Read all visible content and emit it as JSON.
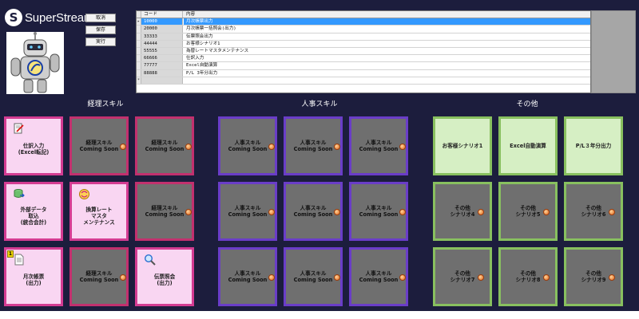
{
  "app": {
    "logo_text": "SuperStream",
    "logo_mark": "S"
  },
  "commands": [
    {
      "label": "取消"
    },
    {
      "label": "保存"
    },
    {
      "label": "実行"
    }
  ],
  "grid": {
    "headers": {
      "code": "コード",
      "content": "内容"
    },
    "rows": [
      {
        "code": "10000",
        "content": "月次帳票出力",
        "selected": true
      },
      {
        "code": "20000",
        "content": "月次帳票一括照会(出力)"
      },
      {
        "code": "33333",
        "content": "伝票照会出力"
      },
      {
        "code": "44444",
        "content": "お客様シナリオ1"
      },
      {
        "code": "55555",
        "content": "為替レートマスタメンテナンス"
      },
      {
        "code": "66666",
        "content": "仕訳入力"
      },
      {
        "code": "77777",
        "content": "Excel自動演算"
      },
      {
        "code": "88888",
        "content": "P/L 3年分出力"
      }
    ],
    "selected_marker": "▸",
    "new_row_marker": "*"
  },
  "sections": {
    "keiri": {
      "title": "経理スキル"
    },
    "jinji": {
      "title": "人事スキル"
    },
    "other": {
      "title": "その他"
    }
  },
  "tiles": {
    "keiri": [
      {
        "label": "仕訳入力\n(Excel転記)",
        "kind": "active",
        "icon": "document-pen-icon"
      },
      {
        "label": "経理スキル\nComing Soon",
        "kind": "soon"
      },
      {
        "label": "経理スキル\nComing Soon",
        "kind": "soon"
      },
      {
        "label": "外部データ\n取込\n(統合会計)",
        "kind": "active",
        "icon": "database-import-icon"
      },
      {
        "label": "換算レート\nマスタ\nメンテナンス",
        "kind": "active",
        "icon": "currency-exchange-icon"
      },
      {
        "label": "経理スキル\nComing Soon",
        "kind": "soon"
      },
      {
        "label": "月次帳票\n(出力)",
        "kind": "active",
        "icon": "report-document-icon",
        "badge": "1"
      },
      {
        "label": "経理スキル\nComing Soon",
        "kind": "soon"
      },
      {
        "label": "伝票照会\n(出力)",
        "kind": "active",
        "icon": "magnifier-icon"
      }
    ],
    "jinji": [
      {
        "label": "人事スキル\nComing Soon"
      },
      {
        "label": "人事スキル\nComing Soon"
      },
      {
        "label": "人事スキル\nComing Soon"
      },
      {
        "label": "人事スキル\nComing Soon"
      },
      {
        "label": "人事スキル\nComing Soon"
      },
      {
        "label": "人事スキル\nComing Soon"
      },
      {
        "label": "人事スキル\nComing Soon"
      },
      {
        "label": "人事スキル\nComing Soon"
      },
      {
        "label": "人事スキル\nComing Soon"
      }
    ],
    "other": [
      {
        "label": "お客様シナリオ1",
        "kind": "active"
      },
      {
        "label": "Excel自動演算",
        "kind": "active"
      },
      {
        "label": "P/L３年分出力",
        "kind": "active"
      },
      {
        "label": "その他\nシナリオ4",
        "kind": "soon"
      },
      {
        "label": "その他\nシナリオ5",
        "kind": "soon"
      },
      {
        "label": "その他\nシナリオ6",
        "kind": "soon"
      },
      {
        "label": "その他\nシナリオ7",
        "kind": "soon"
      },
      {
        "label": "その他\nシナリオ8",
        "kind": "soon"
      },
      {
        "label": "その他\nシナリオ9",
        "kind": "soon"
      }
    ]
  },
  "colors": {
    "background": "#1c1d3d",
    "keiri_border": "#d43c92",
    "jinji_border": "#6a3dc8",
    "other_border": "#88c05f",
    "selected_row": "#3399ff"
  }
}
